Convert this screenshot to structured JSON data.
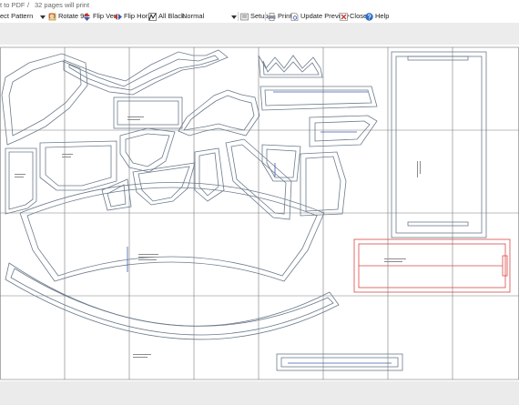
{
  "header": {
    "export_label": "t to PDF",
    "separator": "/",
    "pages_text": "32 pages will print"
  },
  "toolbar": {
    "select_pattern": "ect Pattern",
    "rotate": "Rotate 90",
    "flip_vert": "Flip Vert",
    "flip_horz": "Flip Horz",
    "all_black": "All Black",
    "mode_value": "Normal",
    "setup": "Setup",
    "print": "Print",
    "update_preview": "Update Preview",
    "close": "Close",
    "help": "Help"
  },
  "colors": {
    "grid": "#7a7a7a",
    "pattern": "#6c7b8c",
    "highlight": "#d94a4a",
    "accent": "#3a5bb0"
  }
}
